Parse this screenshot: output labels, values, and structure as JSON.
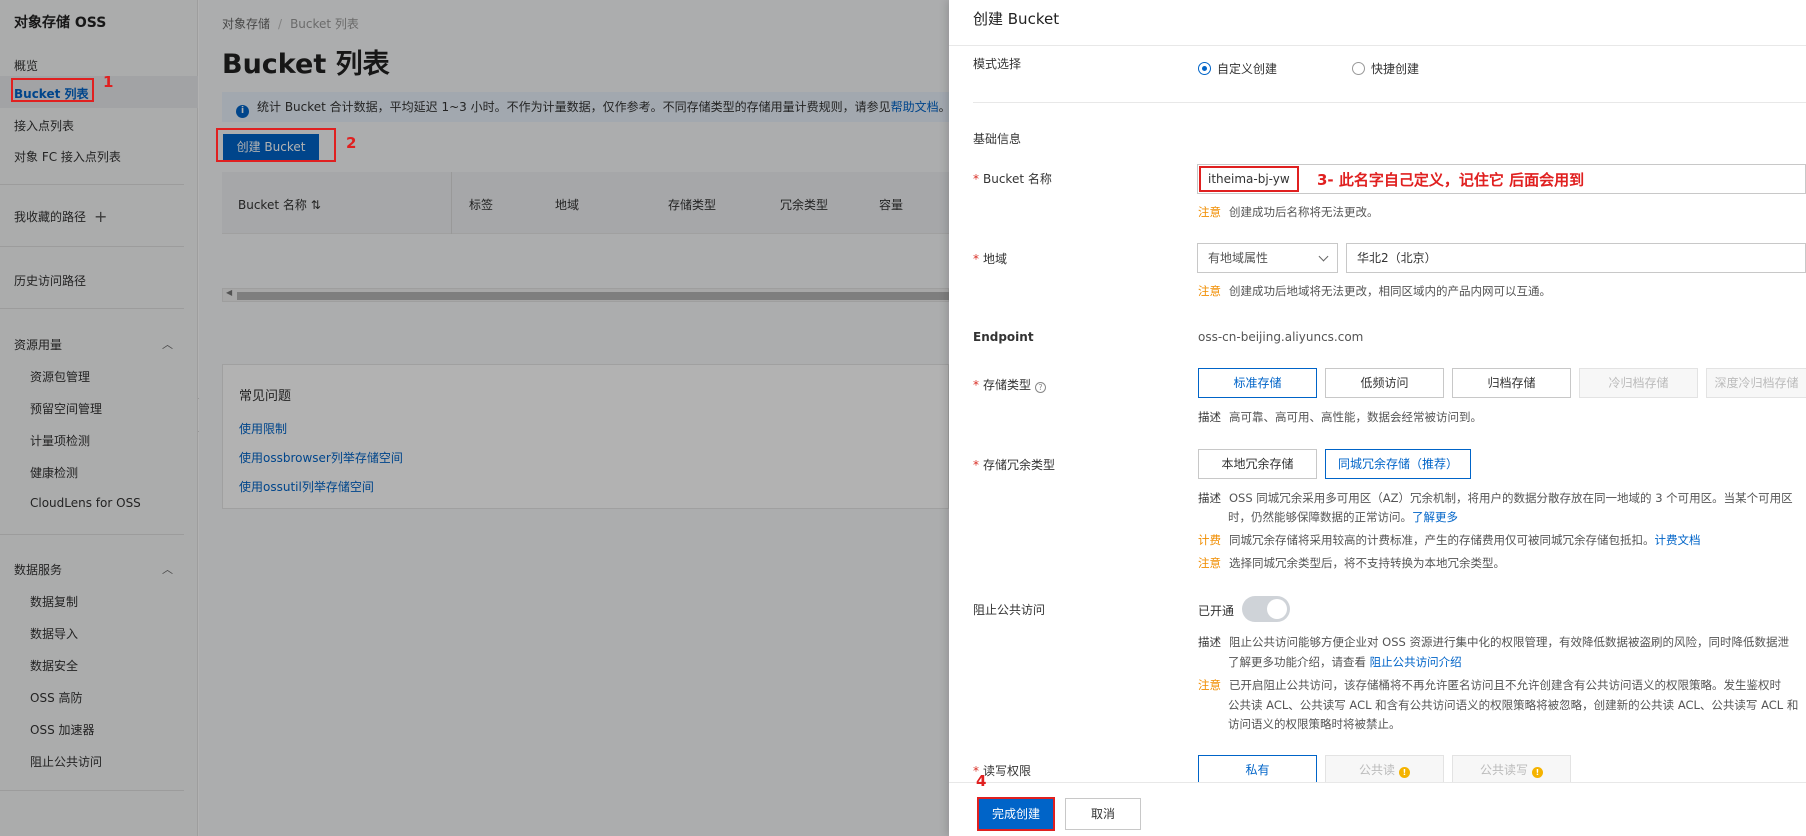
{
  "sidebar": {
    "title": "对象存储 OSS",
    "items": {
      "overview": "概览",
      "bucket_list": "Bucket 列表",
      "access_points": "接入点列表",
      "fc_access_points": "对象 FC 接入点列表",
      "favorites": "我收藏的路径",
      "history": "历史访问路径"
    },
    "resource_group": {
      "title": "资源用量",
      "items": [
        "资源包管理",
        "预留空间管理",
        "计量项检测",
        "健康检测",
        "CloudLens for OSS"
      ]
    },
    "data_group": {
      "title": "数据服务",
      "items": [
        "数据复制",
        "数据导入",
        "数据安全",
        "OSS 高防",
        "OSS 加速器",
        "阻止公共访问"
      ]
    },
    "plus_symbol": "+"
  },
  "main": {
    "breadcrumb": {
      "root": "对象存储",
      "sep": "/",
      "current": "Bucket 列表"
    },
    "title": "Bucket 列表",
    "info_text": "统计 Bucket 合计数据，平均延迟 1~3 小时。不作为计量数据，仅作参考。不同存储类型的存储用量计费规则，请参见",
    "info_link": "帮助文档",
    "info_tail": "。",
    "create_button": "创建 Bucket",
    "table_headers": [
      "Bucket 名称",
      "标签",
      "地域",
      "存储类型",
      "冗余类型",
      "容量"
    ],
    "faq": {
      "title": "常见问题",
      "links": [
        "使用限制",
        "使用ossbrowser列举存储空间",
        "使用ossutil列举存储空间"
      ]
    }
  },
  "annotations": {
    "n1": "1",
    "n2": "2",
    "n4": "4",
    "name_hint": "3- 此名字自己定义，记住它 后面会用到"
  },
  "drawer": {
    "title": "创建 Bucket",
    "mode": {
      "label": "模式选择",
      "options": [
        "自定义创建",
        "快捷创建"
      ],
      "selected": "自定义创建"
    },
    "basic_info": "基础信息",
    "bucket_name": {
      "label": "Bucket 名称",
      "value": "itheima-bj-yw",
      "note_tag": "注意",
      "note": "创建成功后名称将无法更改。"
    },
    "region": {
      "label": "地域",
      "select": "有地域属性",
      "value": "华北2（北京）",
      "note_tag": "注意",
      "note": "创建成功后地域将无法更改，相同区域内的产品内网可以互通。"
    },
    "endpoint": {
      "label": "Endpoint",
      "value": "oss-cn-beijing.aliyuncs.com"
    },
    "storage_class": {
      "label": "存储类型",
      "options": [
        "标准存储",
        "低频访问",
        "归档存储",
        "冷归档存储",
        "深度冷归档存储"
      ],
      "selected": "标准存储",
      "desc_tag": "描述",
      "desc": "高可靠、高可用、高性能，数据会经常被访问到。"
    },
    "redundancy": {
      "label": "存储冗余类型",
      "options": [
        "本地冗余存储",
        "同城冗余存储（推荐）"
      ],
      "selected": "同城冗余存储（推荐）",
      "desc_tag": "描述",
      "desc_line1": "OSS 同城冗余采用多可用区（AZ）冗余机制，将用户的数据分散存放在同一地域的 3 个可用区。当某个可用区",
      "desc_line2": "时，仍然能够保障数据的正常访问。",
      "desc_link": "了解更多",
      "billing_tag": "计费",
      "billing": "同城冗余存储将采用较高的计费标准，产生的存储费用仅可被同城冗余存储包抵扣。",
      "billing_link": "计费文档",
      "note_tag": "注意",
      "note": "选择同城冗余类型后，将不支持转换为本地冗余类型。"
    },
    "block_public": {
      "label": "阻止公共访问",
      "state": "已开通",
      "desc_tag": "描述",
      "desc_line1": "阻止公共访问能够方便企业对 OSS 资源进行集中化的权限管理，有效降低数据被盗刷的风险，同时降低数据泄",
      "desc_line2": "了解更多功能介绍，请查看",
      "desc_link": "阻止公共访问介绍",
      "note_tag": "注意",
      "note_line1": "已开启阻止公共访问，该存储桶将不再允许匿名访问且不允许创建含有公共访问语义的权限策略。发生鉴权时",
      "note_line2": "公共读 ACL、公共读写 ACL 和含有公共访问语义的权限策略将被忽略，创建新的公共读 ACL、公共读写 ACL 和",
      "note_line3": "访问语义的权限策略时将被禁止。"
    },
    "acl": {
      "label": "读写权限",
      "options": [
        "私有",
        "公共读",
        "公共读写"
      ],
      "selected": "私有"
    },
    "footer": {
      "submit": "完成创建",
      "cancel": "取消"
    }
  },
  "colors": {
    "primary": "#0064c8",
    "annotation_red": "#e02020",
    "warning_orange": "#f08d00"
  }
}
